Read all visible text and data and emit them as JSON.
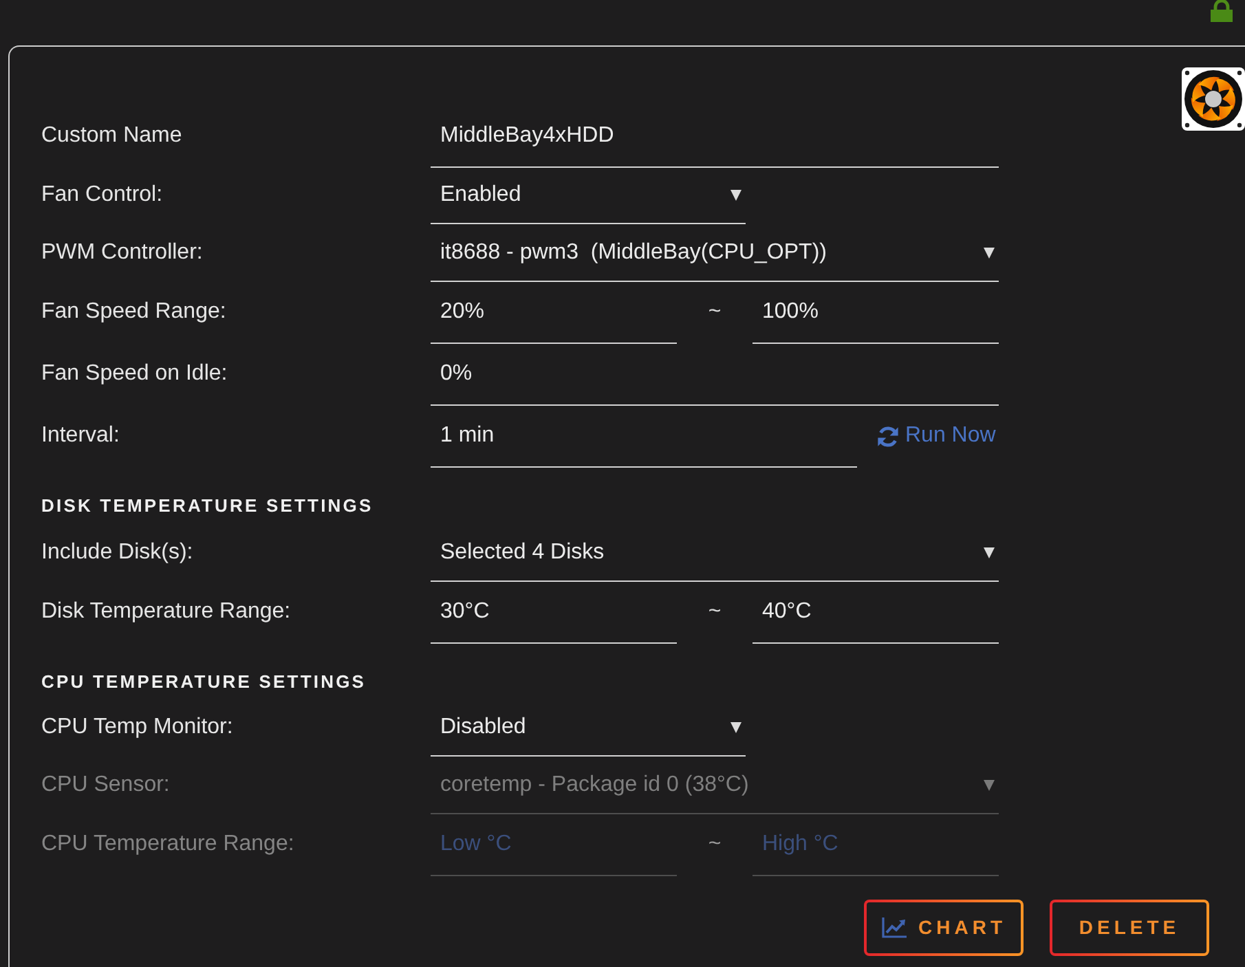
{
  "rows": [
    {
      "kind": "text",
      "label": "Custom Name",
      "value": "MiddleBay4xHDD",
      "disabled": false
    },
    {
      "kind": "toggle",
      "label": "Fan Control:",
      "value": "Enabled",
      "disabled": false
    },
    {
      "kind": "select",
      "label": "PWM Controller:",
      "value": "it8688 - pwm3  (MiddleBay(CPU_OPT))",
      "disabled": false
    },
    {
      "kind": "range",
      "label": "Fan Speed Range:",
      "low": {
        "value": "20%"
      },
      "separator": "~",
      "high": {
        "value": "100%"
      },
      "disabled": false
    },
    {
      "kind": "text",
      "label": "Fan Speed on Idle:",
      "value": "0%",
      "disabled": false
    },
    {
      "kind": "interval",
      "label": "Interval:",
      "value": "1 min",
      "action": "Run Now",
      "disabled": false
    }
  ],
  "sections": [
    {
      "title": "DISK TEMPERATURE SETTINGS",
      "rows": [
        {
          "kind": "select",
          "label": "Include Disk(s):",
          "value": "Selected 4 Disks",
          "disabled": false
        },
        {
          "kind": "range",
          "label": "Disk Temperature Range:",
          "low": {
            "value": "30°C"
          },
          "separator": "~",
          "high": {
            "value": "40°C"
          },
          "disabled": false
        }
      ]
    },
    {
      "title": "CPU TEMPERATURE SETTINGS",
      "rows": [
        {
          "kind": "toggle",
          "label": "CPU Temp Monitor:",
          "value": "Disabled",
          "disabled": false
        },
        {
          "kind": "select",
          "label": "CPU Sensor:",
          "value": "coretemp - Package id 0 (38°C)",
          "disabled": true
        },
        {
          "kind": "range",
          "label": "CPU Temperature Range:",
          "low": {
            "placeholder": "Low °C"
          },
          "separator": "~",
          "high": {
            "placeholder": "High °C"
          },
          "disabled": true
        }
      ]
    }
  ],
  "buttons": [
    {
      "kind": "chart",
      "label": "CHART"
    },
    {
      "kind": "delete",
      "label": "DELETE"
    }
  ]
}
